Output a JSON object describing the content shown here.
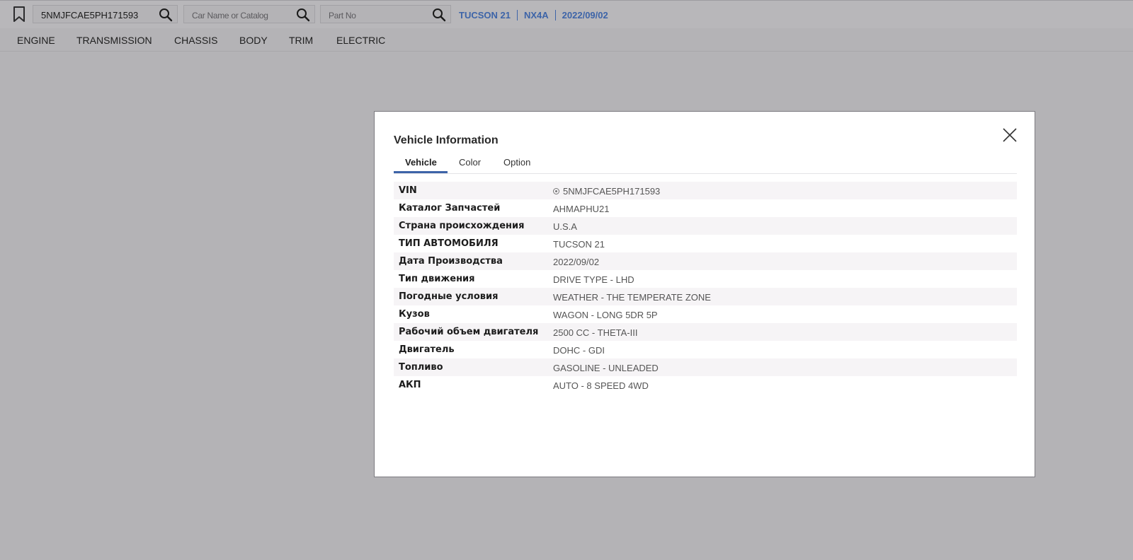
{
  "toolbar": {
    "vin_search_value": "5NMJFCAE5PH171593",
    "car_search_placeholder": "Car Name or Catalog",
    "part_search_placeholder": "Part No",
    "vehicle_tags": [
      "TUCSON 21",
      "NX4A",
      "2022/09/02"
    ],
    "accent_color": "#3d64a8"
  },
  "menu": {
    "items": [
      "ENGINE",
      "TRANSMISSION",
      "CHASSIS",
      "BODY",
      "TRIM",
      "ELECTRIC"
    ]
  },
  "modal": {
    "title": "Vehicle Information",
    "tabs": [
      "Vehicle",
      "Color",
      "Option"
    ],
    "active_tab": "Vehicle",
    "rows": [
      {
        "label": "VIN",
        "value": "5NMJFCAE5PH171593"
      },
      {
        "label": "Каталог Запчастей",
        "value": "AHMAPHU21"
      },
      {
        "label": "Страна происхождения",
        "value": "U.S.A"
      },
      {
        "label": "ТИП АВТОМОБИЛЯ",
        "value": "TUCSON 21"
      },
      {
        "label": "Дата Производства",
        "value": "2022/09/02"
      },
      {
        "label": "Тип движения",
        "value": "DRIVE TYPE - LHD"
      },
      {
        "label": "Погодные условия",
        "value": "WEATHER - THE TEMPERATE ZONE"
      },
      {
        "label": "Кузов",
        "value": "WAGON - LONG 5DR 5P"
      },
      {
        "label": "Рабочий объем двигателя",
        "value": "2500 CC - THETA-III"
      },
      {
        "label": "Двигатель",
        "value": "DOHC - GDI"
      },
      {
        "label": "Топливо",
        "value": "GASOLINE - UNLEADED"
      },
      {
        "label": "АКП",
        "value": "AUTO - 8 SPEED 4WD"
      }
    ]
  },
  "icons": {
    "bookmark": "bookmark-icon",
    "search": "search-icon",
    "close": "close-icon",
    "vin": "vin-circle-icon"
  }
}
